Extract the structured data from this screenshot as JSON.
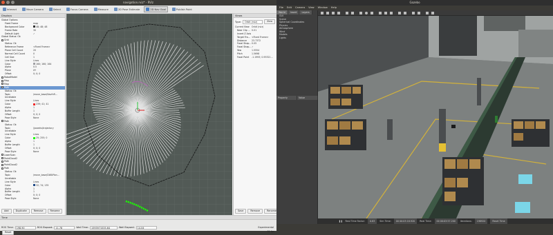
{
  "rviz": {
    "title": "navigation.rviz* - RViz",
    "toolbar": [
      {
        "label": "Interact",
        "icon": "interact-icon",
        "active": false
      },
      {
        "label": "Move Camera",
        "icon": "move-camera-icon",
        "active": false
      },
      {
        "label": "Select",
        "icon": "select-icon",
        "active": false
      },
      {
        "label": "Focus Camera",
        "icon": "focus-camera-icon",
        "active": false
      },
      {
        "label": "Measure",
        "icon": "measure-icon",
        "active": false
      },
      {
        "label": "2D Pose Estimate",
        "icon": "pose-estimate-icon",
        "active": false
      },
      {
        "label": "2D Nav Goal",
        "icon": "nav-goal-icon",
        "active": true
      },
      {
        "label": "Publish Point",
        "icon": "publish-point-icon",
        "active": false
      }
    ],
    "displays_title": "Displays",
    "displays": [
      {
        "k": "Global Options",
        "v": "",
        "d": 0
      },
      {
        "k": "Fixed Frame",
        "v": "map",
        "d": 1
      },
      {
        "k": "Background Color",
        "v": "48; 48; 48",
        "d": 1,
        "color": "#303030"
      },
      {
        "k": "Frame Rate",
        "v": "30",
        "d": 1
      },
      {
        "k": "Default Light",
        "v": "✓",
        "d": 1
      },
      {
        "k": "Global Status: Ok",
        "v": "",
        "d": 0
      },
      {
        "k": "Grid",
        "v": "",
        "d": 0,
        "check": true
      },
      {
        "k": "Status: Ok",
        "v": "",
        "d": 1
      },
      {
        "k": "Reference Frame",
        "v": "<Fixed Frame>",
        "d": 1
      },
      {
        "k": "Plane Cell Count",
        "v": "20",
        "d": 1
      },
      {
        "k": "Normal Cell Count",
        "v": "0",
        "d": 1
      },
      {
        "k": "Cell Size",
        "v": "1",
        "d": 1
      },
      {
        "k": "Line Style",
        "v": "Lines",
        "d": 1
      },
      {
        "k": "Color",
        "v": "160; 160; 164",
        "d": 1,
        "color": "#a0a0a4"
      },
      {
        "k": "Alpha",
        "v": "0.5",
        "d": 1
      },
      {
        "k": "Plane",
        "v": "XY",
        "d": 1
      },
      {
        "k": "Offset",
        "v": "0; 0; 0",
        "d": 1
      },
      {
        "k": "RobotModel",
        "v": "",
        "d": 0,
        "check": true
      },
      {
        "k": "Map",
        "v": "",
        "d": 0,
        "check": true
      },
      {
        "k": "Map",
        "v": "",
        "d": 0,
        "check": true
      },
      {
        "k": "Path",
        "v": "",
        "d": 0,
        "check": true,
        "sel": true
      },
      {
        "k": "Status: Ok",
        "v": "",
        "d": 1
      },
      {
        "k": "Topic",
        "v": "/move_base/NavfnR...",
        "d": 1
      },
      {
        "k": "Unreliable",
        "v": "",
        "d": 1
      },
      {
        "k": "Line Style",
        "v": "Lines",
        "d": 1
      },
      {
        "k": "Color",
        "v": "239; 41; 41",
        "d": 1,
        "color": "#ef2929"
      },
      {
        "k": "Alpha",
        "v": "1",
        "d": 1
      },
      {
        "k": "Buffer Length",
        "v": "1",
        "d": 1
      },
      {
        "k": "Offset",
        "v": "0; 0; 0",
        "d": 1
      },
      {
        "k": "Pose Style",
        "v": "None",
        "d": 1
      },
      {
        "k": "Path",
        "v": "",
        "d": 0,
        "check": true
      },
      {
        "k": "Status: Ok",
        "v": "",
        "d": 1
      },
      {
        "k": "Topic",
        "v": "/joseeks/trajectory",
        "d": 1
      },
      {
        "k": "Unreliable",
        "v": "",
        "d": 1
      },
      {
        "k": "Line Style",
        "v": "Lines",
        "d": 1
      },
      {
        "k": "Color",
        "v": "25; 255; 0",
        "d": 1,
        "color": "#19ff00"
      },
      {
        "k": "Alpha",
        "v": "1",
        "d": 1
      },
      {
        "k": "Buffer Length",
        "v": "1",
        "d": 1
      },
      {
        "k": "Offset",
        "v": "0; 0; 0",
        "d": 1
      },
      {
        "k": "Pose Style",
        "v": "None",
        "d": 1
      },
      {
        "k": "LaserScan",
        "v": "",
        "d": 0,
        "check": true
      },
      {
        "k": "PointCloud2",
        "v": "",
        "d": 0,
        "check": true
      },
      {
        "k": "Path",
        "v": "",
        "d": 0,
        "check": true
      },
      {
        "k": "PointCloud2",
        "v": "",
        "d": 0,
        "check": true
      },
      {
        "k": "Path",
        "v": "",
        "d": 0,
        "check": true
      },
      {
        "k": "Status: Ok",
        "v": "",
        "d": 1
      },
      {
        "k": "Topic",
        "v": "/move_base/DWAPlan...",
        "d": 1
      },
      {
        "k": "Unreliable",
        "v": "",
        "d": 1
      },
      {
        "k": "Line Style",
        "v": "Lines",
        "d": 1
      },
      {
        "k": "Color",
        "v": "32; 74; 135",
        "d": 1,
        "color": "#204a87"
      },
      {
        "k": "Alpha",
        "v": "1",
        "d": 1
      },
      {
        "k": "Buffer Length",
        "v": "1",
        "d": 1
      },
      {
        "k": "Offset",
        "v": "0; 0; 0",
        "d": 1
      },
      {
        "k": "Pose Style",
        "v": "None",
        "d": 1
      }
    ],
    "display_buttons": [
      "Add",
      "Duplicate",
      "Remove",
      "Rename"
    ],
    "views_title": "Views",
    "views": {
      "type_label": "Type:",
      "type_value": "Orbit (rviz)",
      "zero_label": "Zero",
      "rows": [
        {
          "k": "Current View",
          "v": "Orbit (rviz)"
        },
        {
          "k": "Near Clip ...",
          "v": "0.01"
        },
        {
          "k": "Invert Z Axis",
          "v": ""
        },
        {
          "k": "Target Fra...",
          "v": "<Fixed Frame>"
        },
        {
          "k": "Distance",
          "v": "23.7372"
        },
        {
          "k": "Focal Shap...",
          "v": "0.05"
        },
        {
          "k": "Focal Shap...",
          "v": "✓"
        },
        {
          "k": "Yaw",
          "v": "1.5554"
        },
        {
          "k": "Pitch",
          "v": "1.5698"
        },
        {
          "k": "Focal Point",
          "v": "-1.1993; 0.95321..."
        }
      ],
      "buttons": [
        "Save",
        "Remove",
        "Rename"
      ]
    },
    "time": {
      "label": "Time",
      "ros_time_label": "ROS Time:",
      "ros_time": "198.90",
      "ros_elapsed_label": "ROS Elapsed:",
      "ros_elapsed": "11.78",
      "wall_time_label": "Wall Time:",
      "wall_time": "1593971535.64",
      "wall_elapsed_label": "Wall Elapsed:",
      "wall_elapsed": "14.04",
      "experimental": "Experimental",
      "reset": "Reset",
      "fps": "31 fps"
    }
  },
  "gazebo": {
    "title": "Gazebo",
    "menu": [
      "File",
      "Edit",
      "Camera",
      "View",
      "Window",
      "Help"
    ],
    "tabs": [
      "World",
      "Insert",
      "Layers"
    ],
    "tree": [
      "GUI",
      "Scene",
      "Spherical Coordinates",
      "Physics",
      "Atmosphere",
      "Wind",
      "Models",
      "Lights"
    ],
    "property_cols": [
      "Property",
      "Value"
    ],
    "bottom": {
      "real_time_factor_label": "Real Time Factor:",
      "real_time_factor": "0.83",
      "sim_time_label": "Sim Time:",
      "sim_time": "00 00:03:18.920",
      "real_time_label": "Real Time:",
      "real_time": "00 00:03:57.200",
      "iterations_label": "Iterations:",
      "iterations": "198920",
      "reset_label": "Reset Time"
    }
  },
  "colors": {
    "rviz_grid_bg": "#525a56",
    "selected_row": "#6c98d1",
    "path_green": "#19ff00"
  }
}
